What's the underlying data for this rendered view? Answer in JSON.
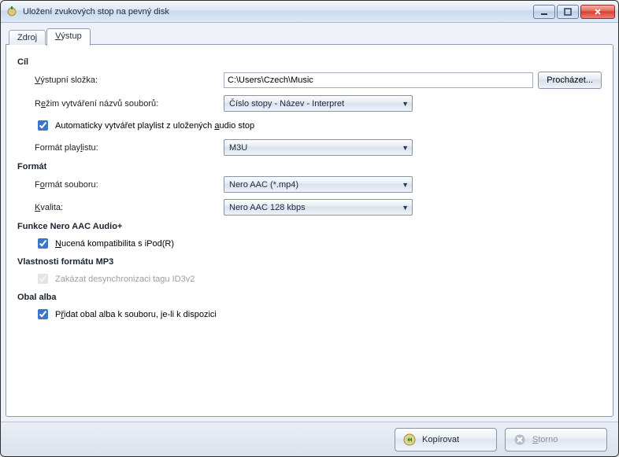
{
  "window": {
    "title": "Uložení zvukových stop na pevný disk"
  },
  "tabs": {
    "source": "Zdroj",
    "output_prefix": "V",
    "output_suffix": "ýstup"
  },
  "dest": {
    "header": "Cíl",
    "outfolder_label_prefix": "V",
    "outfolder_label_suffix": "ýstupní složka:",
    "outfolder_value": "C:\\Users\\Czech\\Music",
    "browse_prefix": "P",
    "browse_suffix": "rocházet...",
    "naming_label_pre": "R",
    "naming_label_u": "e",
    "naming_label_post": "žim vytváření názvů souborů:",
    "naming_value": "Číslo stopy - Název - Interpret",
    "autoplaylist_pre": "Automaticky vytvářet playlist z uložených ",
    "autoplaylist_u": "a",
    "autoplaylist_post": "udio stop",
    "playlistfmt_label_pre": "Formát play",
    "playlistfmt_label_u": "l",
    "playlistfmt_label_post": "istu:",
    "playlistfmt_value": "M3U"
  },
  "format": {
    "header": "Formát",
    "filefmt_label_pre": "F",
    "filefmt_label_u": "o",
    "filefmt_label_post": "rmát souboru:",
    "filefmt_value": "Nero AAC (*.mp4)",
    "quality_label_u": "K",
    "quality_label_post": "valita:",
    "quality_value": "Nero AAC 128 kbps"
  },
  "aacplus": {
    "header": "Funkce Nero AAC Audio+",
    "ipod_u": "N",
    "ipod_post": "ucená kompatibilita s iPod(R)"
  },
  "mp3": {
    "header": "Vlastnosti formátu MP3",
    "id3_pre": "Zakázat desynchronizaci tagu ID3v2"
  },
  "album": {
    "header": "Obal alba",
    "add_pre": "P",
    "add_u": "ř",
    "add_post": "idat obal alba k souboru, je-li k dispozici"
  },
  "buttons": {
    "copy": "Kopírovat",
    "cancel_u": "S",
    "cancel_post": "torno"
  }
}
